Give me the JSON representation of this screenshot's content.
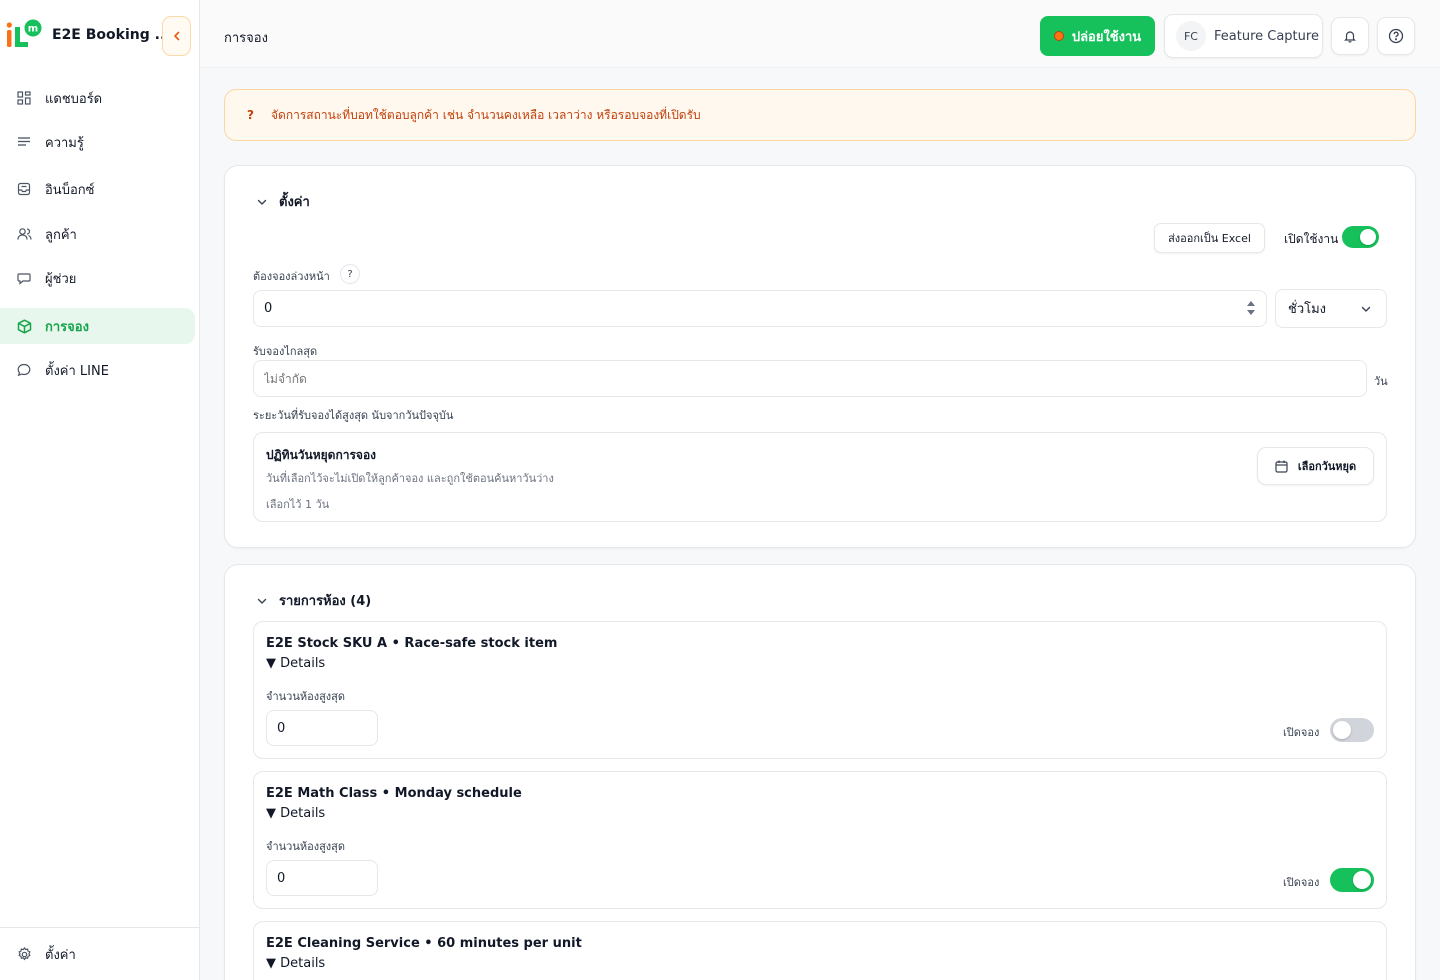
{
  "sidebar": {
    "brand_name": "E2E Booking ...",
    "items": [
      {
        "label": "แดชบอร์ด",
        "icon": "grid-icon"
      },
      {
        "label": "ความรู้",
        "icon": "lines-icon"
      },
      {
        "label": "อินบ็อกซ์",
        "icon": "inbox-icon"
      },
      {
        "label": "ลูกค้า",
        "icon": "users-icon"
      },
      {
        "label": "ผู้ช่วย",
        "icon": "chat-icon"
      },
      {
        "label": "การจอง",
        "icon": "box-icon"
      },
      {
        "label": "ตั้งค่า LINE",
        "icon": "chat-bubble-icon"
      }
    ],
    "bottom_label": "ตั้งค่า"
  },
  "header": {
    "breadcrumb": "การจอง",
    "release_label": "ปล่อยใช้งาน",
    "feature_avatar": "FC",
    "feature_label": "Feature Capture"
  },
  "alert": {
    "mark": "?",
    "text": "จัดการสถานะที่บอทใช้ตอบลูกค้า เช่น จำนวนคงเหลือ เวลาว่าง หรือรอบจองที่เปิดรับ"
  },
  "settings": {
    "title": "ตั้งค่า",
    "export_label": "ส่งออกเป็น Excel",
    "enable_label": "เปิดใช้งาน",
    "enabled": true,
    "advance_label": "ต้องจองล่วงหน้า",
    "advance_help": "?",
    "advance_value": "0",
    "unit_value": "ชั่วโมง",
    "max_label": "รับจองไกลสุด",
    "max_placeholder": "ไม่จำกัด",
    "max_unit": "วัน",
    "max_hint": "ระยะวันที่รับจองได้สูงสุด นับจากวันปัจจุบัน",
    "holiday": {
      "title": "ปฏิทินวันหยุดการจอง",
      "desc": "วันที่เลือกไว้จะไม่เปิดให้ลูกค้าจอง และถูกใช้ตอนค้นหาวันว่าง",
      "selected": "เลือกไว้ 1 วัน",
      "button": "เลือกวันหยุด"
    }
  },
  "rooms": {
    "title": "รายการห้อง (4)",
    "max_label": "จำนวนห้องสูงสุด",
    "open_label": "เปิดจอง",
    "details_label": "▼ Details",
    "items": [
      {
        "title": "E2E Stock SKU A • Race-safe stock item",
        "max_value": "0",
        "open": false
      },
      {
        "title": "E2E Math Class • Monday schedule",
        "max_value": "0",
        "open": true
      },
      {
        "title": "E2E Cleaning Service • 60 minutes per unit"
      }
    ]
  },
  "colors": {
    "accent": "#16c15c",
    "alert_text": "#c2410c",
    "alert_bg": "#fff8ef"
  }
}
